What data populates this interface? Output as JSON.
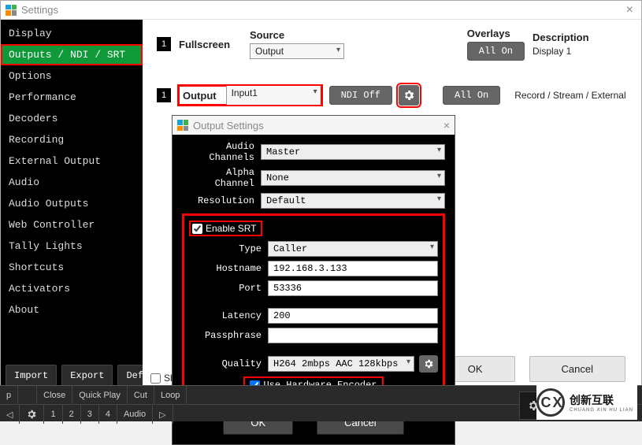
{
  "settings": {
    "title": "Settings",
    "close": "×"
  },
  "sidebar": {
    "items": [
      {
        "label": "Display"
      },
      {
        "label": "Outputs / NDI / SRT"
      },
      {
        "label": "Options"
      },
      {
        "label": "Performance"
      },
      {
        "label": "Decoders"
      },
      {
        "label": "Recording"
      },
      {
        "label": "External Output"
      },
      {
        "label": "Audio"
      },
      {
        "label": "Audio Outputs"
      },
      {
        "label": "Web Controller"
      },
      {
        "label": "Tally Lights"
      },
      {
        "label": "Shortcuts"
      },
      {
        "label": "Activators"
      },
      {
        "label": "About"
      }
    ],
    "buttons": {
      "import": "Import",
      "export": "Export",
      "default": "Default"
    }
  },
  "main": {
    "row1": {
      "num": "1",
      "fullscreen": "Fullscreen",
      "source_label": "Source",
      "source_value": "Output",
      "overlays_label": "Overlays",
      "overlays_value": "All On",
      "description_label": "Description",
      "description_value": "Display 1"
    },
    "row2": {
      "num": "1",
      "output_label": "Output",
      "output_value": "Input1",
      "ndi": "NDI Off",
      "overlays_value": "All On",
      "description_value": "Record / Stream / External"
    },
    "show_check": "Sh",
    "footer": {
      "ok": "OK",
      "cancel": "Cancel"
    }
  },
  "output_settings": {
    "title": "Output Settings",
    "close": "×",
    "audio_channels_label": "Audio Channels",
    "audio_channels_value": "Master",
    "alpha_label": "Alpha Channel",
    "alpha_value": "None",
    "resolution_label": "Resolution",
    "resolution_value": "Default",
    "enable_srt": "Enable SRT",
    "type_label": "Type",
    "type_value": "Caller",
    "hostname_label": "Hostname",
    "hostname_value": "192.168.3.133",
    "port_label": "Port",
    "port_value": "53336",
    "latency_label": "Latency",
    "latency_value": "200",
    "passphrase_label": "Passphrase",
    "passphrase_value": "",
    "quality_label": "Quality",
    "quality_value": "H264 2mbps AAC 128kbps",
    "hw_encoder": "Use Hardware Encoder",
    "ok": "OK",
    "cancel": "Cancel"
  },
  "bottombar": {
    "close": "Close",
    "quickplay": "Quick Play",
    "cut": "Cut",
    "loop": "Loop",
    "p": "p",
    "n1": "1",
    "n2": "2",
    "n3": "3",
    "n4": "4",
    "audio": "Audio"
  },
  "logo": {
    "cn": "创新互联",
    "py": "CHUANG XIN HU LIAN"
  }
}
